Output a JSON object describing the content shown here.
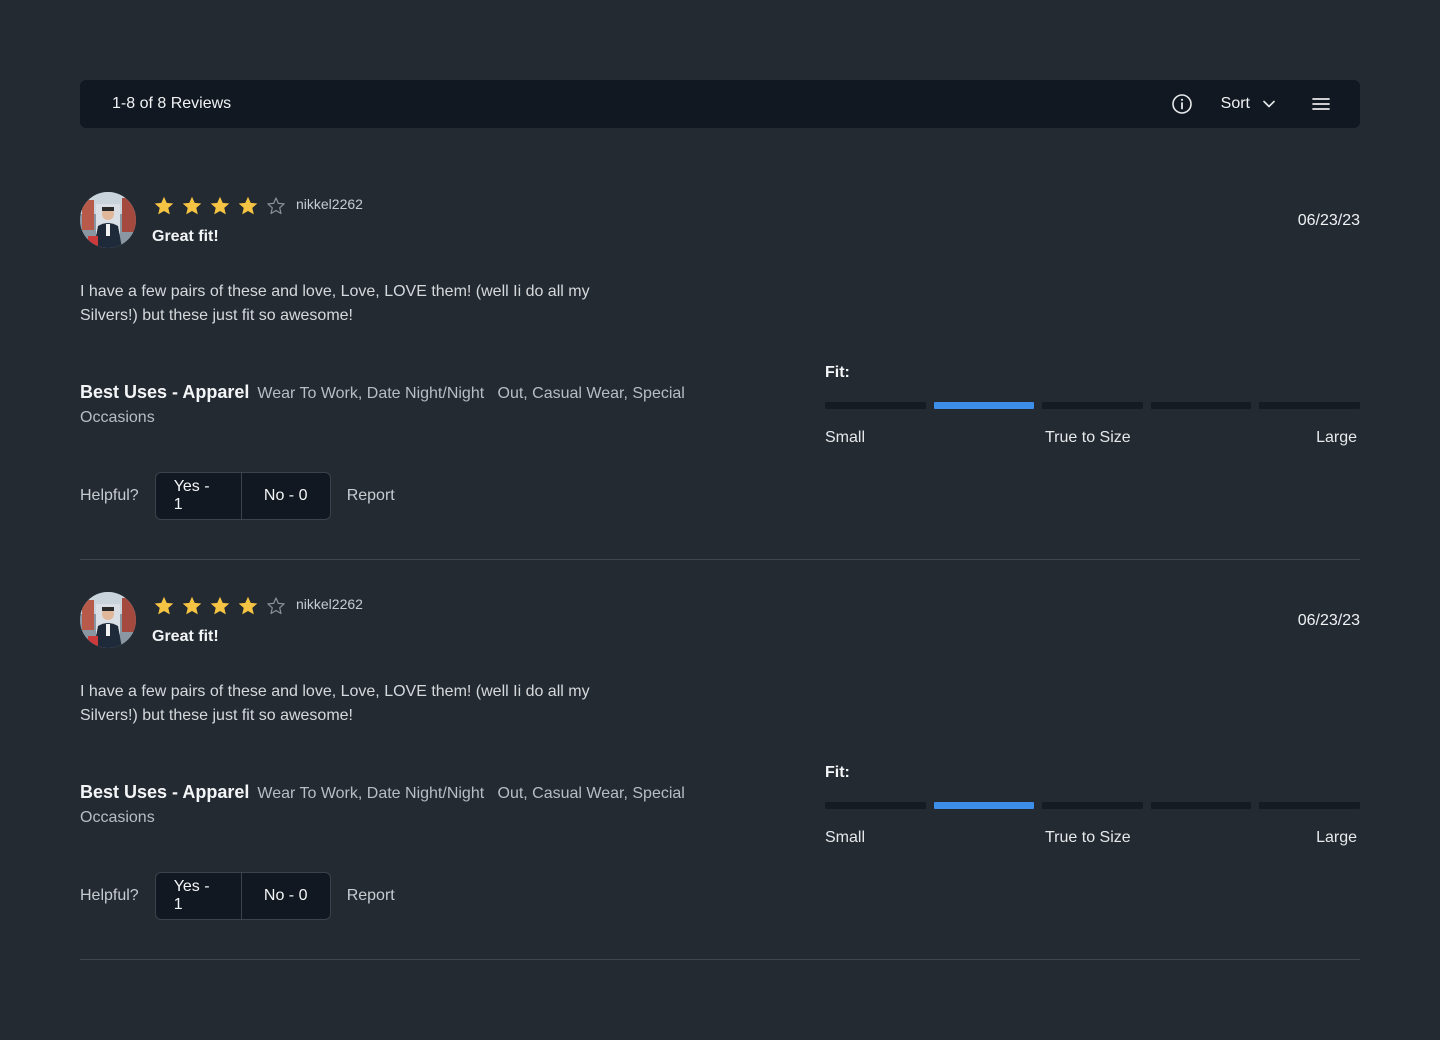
{
  "header": {
    "count_label": "1-8 of 8 Reviews",
    "sort_label": "Sort"
  },
  "reviews": [
    {
      "rating": 4,
      "max_rating": 5,
      "username": "nikkel2262",
      "title": "Great fit!",
      "date": "06/23/23",
      "body": "I have a few pairs of these and love, Love, LOVE them! (well Ii do all my Silvers!) but these just fit so awesome!",
      "uses_label": "Best Uses - Apparel",
      "uses_value": "Wear To Work, Date Night/Night   Out, Casual Wear, Special Occasions",
      "fit": {
        "label": "Fit:",
        "segments": 5,
        "selected": 2,
        "scale_small": "Small",
        "scale_true": "True to Size",
        "scale_large": "Large"
      },
      "helpful_label": "Helpful?",
      "yes_label": "Yes - 1",
      "no_label": "No - 0",
      "report_label": "Report"
    },
    {
      "rating": 4,
      "max_rating": 5,
      "username": "nikkel2262",
      "title": "Great fit!",
      "date": "06/23/23",
      "body": "I have a few pairs of these and love, Love, LOVE them! (well Ii do all my Silvers!) but these just fit so awesome!",
      "uses_label": "Best Uses - Apparel",
      "uses_value": "Wear To Work, Date Night/Night   Out, Casual Wear, Special Occasions",
      "fit": {
        "label": "Fit:",
        "segments": 5,
        "selected": 2,
        "scale_small": "Small",
        "scale_true": "True to Size",
        "scale_large": "Large"
      },
      "helpful_label": "Helpful?",
      "yes_label": "Yes - 1",
      "no_label": "No - 0",
      "report_label": "Report"
    }
  ],
  "colors": {
    "background": "#232a32",
    "bar": "#111821",
    "star": "#f6c443",
    "fit_active": "#3d8ee8"
  },
  "icons": {
    "info": "info-circle-icon",
    "sort": "chevron-down-icon",
    "menu": "hamburger-menu-icon",
    "star": "star-icon"
  }
}
